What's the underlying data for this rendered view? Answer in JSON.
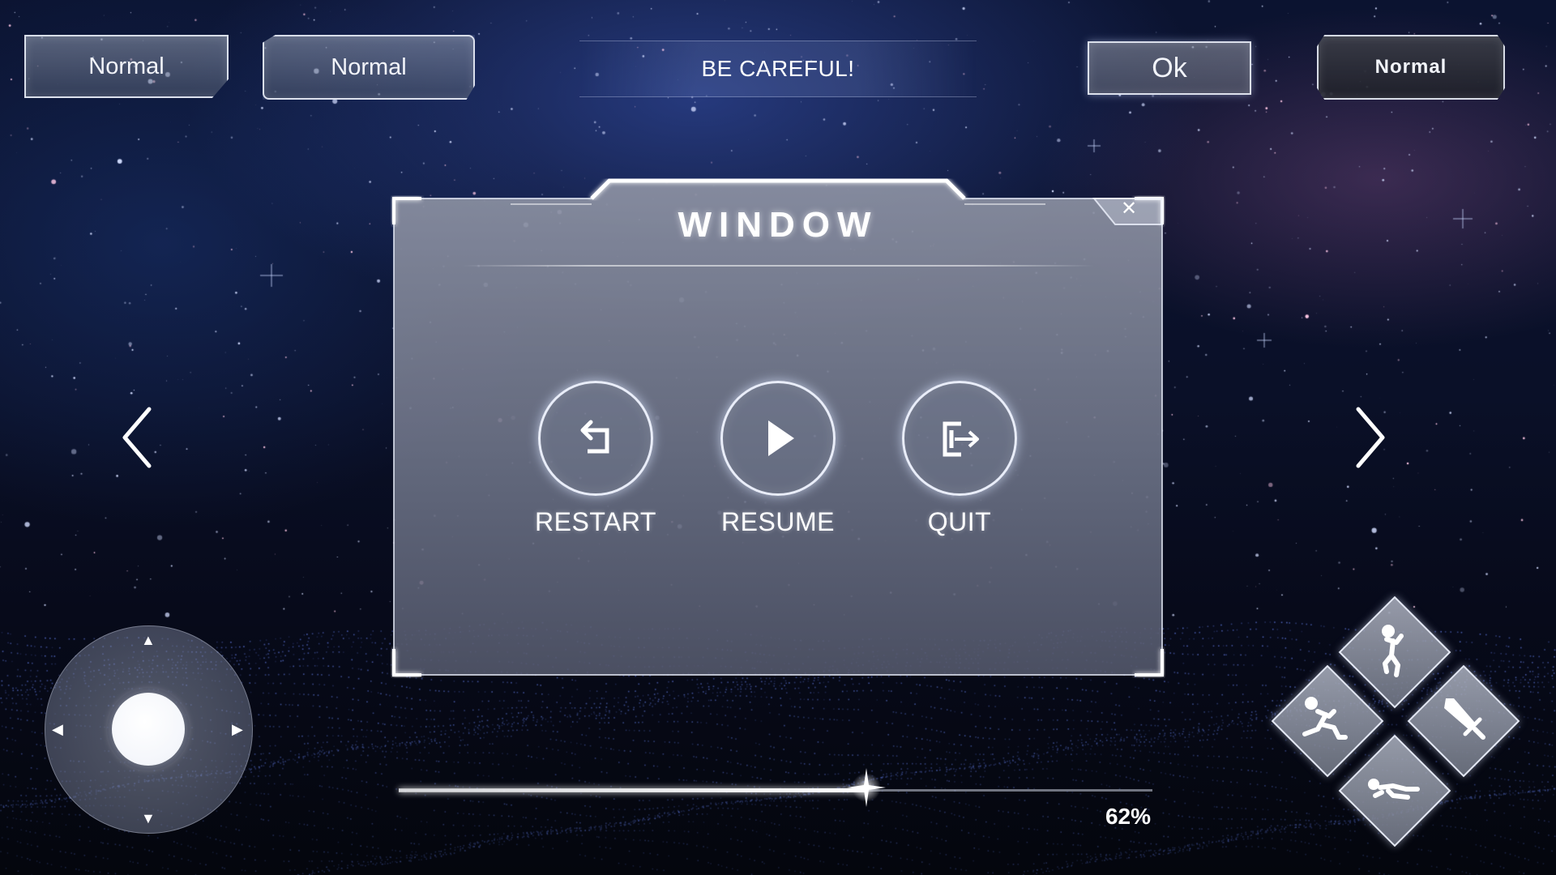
{
  "topbar": {
    "button_1": "Normal",
    "button_2": "Normal",
    "banner": "BE CAREFUL!",
    "ok": "Ok",
    "button_3": "Normal"
  },
  "window": {
    "title": "WINDOW",
    "close": "✕",
    "actions": [
      {
        "label": "RESTART",
        "icon": "restart-icon"
      },
      {
        "label": "RESUME",
        "icon": "play-icon"
      },
      {
        "label": "QUIT",
        "icon": "exit-icon"
      }
    ]
  },
  "navigation": {
    "prev_icon": "chevron-left-icon",
    "next_icon": "chevron-right-icon"
  },
  "progress": {
    "value": 0.62,
    "text": "62%"
  },
  "joystick": {
    "arrows": {
      "up": "▲",
      "down": "▼",
      "left": "◀",
      "right": "▶"
    }
  },
  "skills": [
    {
      "icon": "jump-icon"
    },
    {
      "icon": "run-icon"
    },
    {
      "icon": "sword-icon"
    },
    {
      "icon": "slide-icon"
    }
  ],
  "colors": {
    "background": "#0a1028",
    "panel": "#8a90a2",
    "accent": "#ffffff"
  }
}
